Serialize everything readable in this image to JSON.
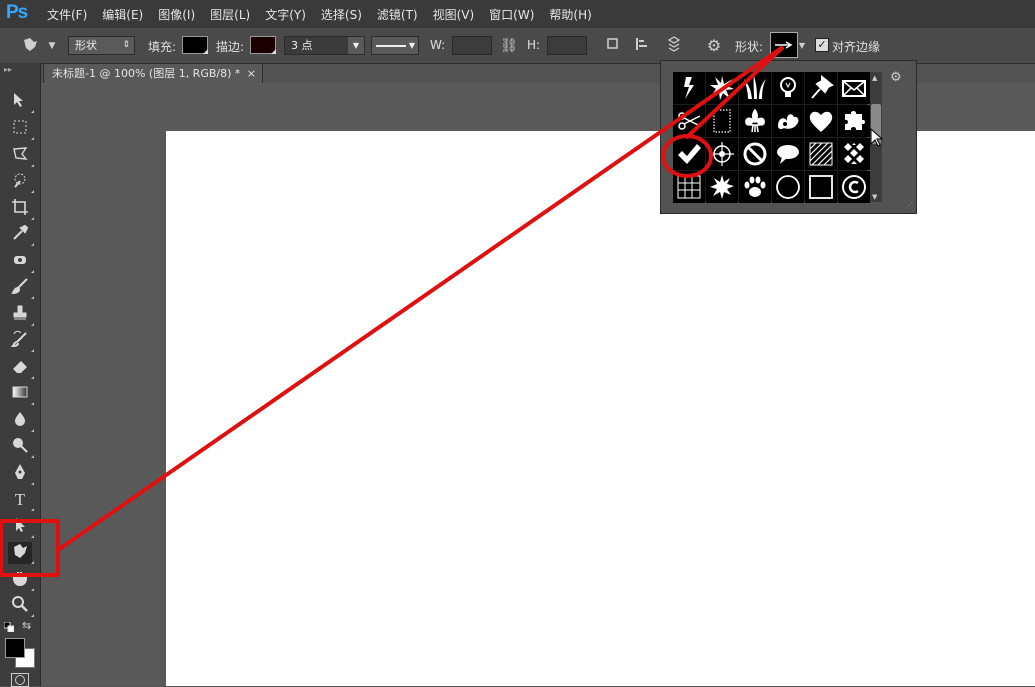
{
  "app": {
    "logo": "Ps"
  },
  "menu": [
    "文件(F)",
    "编辑(E)",
    "图像(I)",
    "图层(L)",
    "文字(Y)",
    "选择(S)",
    "滤镜(T)",
    "视图(V)",
    "窗口(W)",
    "帮助(H)"
  ],
  "options": {
    "mode_value": "形状",
    "fill_label": "填充:",
    "stroke_label": "描边:",
    "stroke_width": "3 点",
    "w_label": "W:",
    "h_label": "H:",
    "shape_label": "形状:",
    "align_edges_label": "对齐边缘",
    "align_edges_checked": true,
    "fill_color": "#000000",
    "stroke_color": "#1a0000"
  },
  "document": {
    "tab_title": "未标题-1 @ 100% (图层 1, RGB/8) *",
    "close": "×"
  },
  "shape_picker": {
    "shapes": [
      "lightning",
      "starburst",
      "grass",
      "lightbulb",
      "pushpin",
      "envelope",
      "scissors",
      "frame",
      "fleur-de-lis",
      "ornament",
      "heart",
      "puzzle",
      "checkmark",
      "target",
      "no-symbol",
      "speech-bubble",
      "diagonal-lines",
      "checkerboard",
      "grid",
      "sun-burst",
      "paw-print",
      "circle",
      "square",
      "copyright"
    ],
    "selected": "checkmark"
  },
  "annotations": {
    "color": "#e01010"
  },
  "toolbox": [
    "move",
    "marquee",
    "lasso",
    "quick-select",
    "crop",
    "eyedropper",
    "spot-heal",
    "brush",
    "stamp",
    "history-brush",
    "eraser",
    "gradient",
    "blur",
    "dodge",
    "pen",
    "type",
    "path-select",
    "custom-shape",
    "hand",
    "zoom"
  ]
}
